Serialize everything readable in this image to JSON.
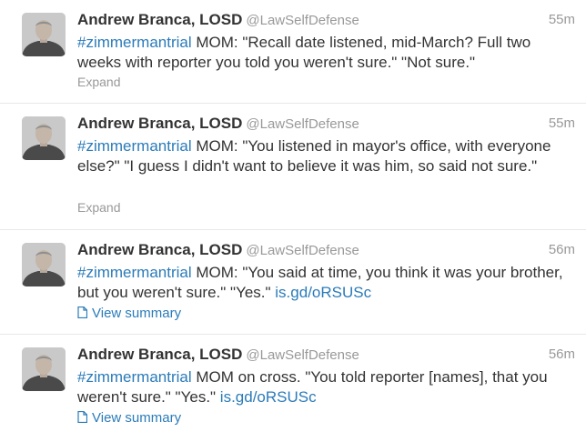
{
  "tweets": [
    {
      "fullname": "Andrew Branca, LOSD",
      "username": "@LawSelfDefense",
      "time": "55m",
      "hashtag": "#zimmermantrial",
      "text": " MOM: \"Recall date listened, mid-March? Full two weeks with reporter you told you weren't sure.\" \"Not sure.\"",
      "link": "",
      "action": "Expand"
    },
    {
      "fullname": "Andrew Branca, LOSD",
      "username": "@LawSelfDefense",
      "time": "55m",
      "hashtag": "#zimmermantrial",
      "text": "  MOM: \"You listened in mayor's office, with everyone else?\" \"I guess I didn't want to believe it was him, so said not sure.\"",
      "link": "",
      "action": "Expand"
    },
    {
      "fullname": "Andrew Branca, LOSD",
      "username": "@LawSelfDefense",
      "time": "56m",
      "hashtag": "#zimmermantrial",
      "text": "  MOM: \"You said at time, you think it was your brother, but you weren't sure.\"  \"Yes.\" ",
      "link": "is.gd/oRSUSc",
      "action": "View summary"
    },
    {
      "fullname": "Andrew Branca, LOSD",
      "username": "@LawSelfDefense",
      "time": "56m",
      "hashtag": "#zimmermantrial",
      "text": "  MOM on cross.  \"You told reporter [names], that you weren't sure.\"  \"Yes.\" ",
      "link": "is.gd/oRSUSc",
      "action": "View summary"
    }
  ],
  "icons": {
    "summary": "document-icon",
    "avatar": "profile-photo"
  }
}
